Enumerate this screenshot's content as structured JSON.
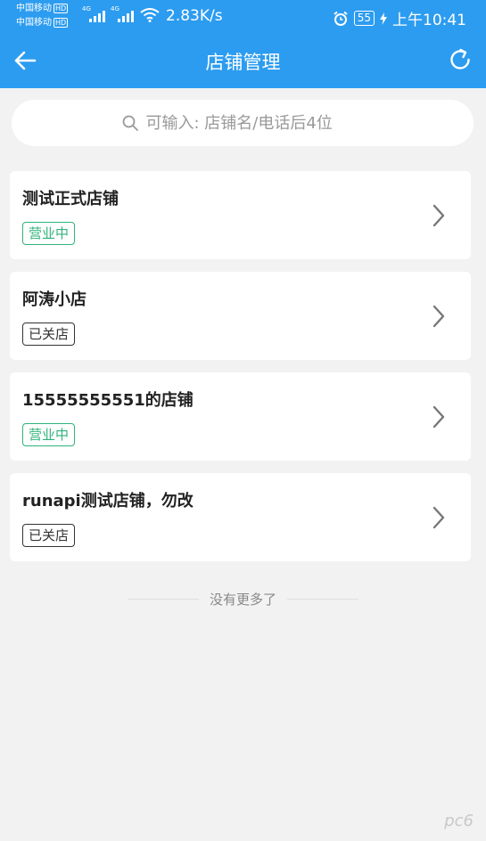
{
  "status_bar": {
    "carrier1": "中国移动",
    "carrier2": "中国移动",
    "hd": "HD",
    "net1": "4G",
    "net2": "4G",
    "speed": "2.83K/s",
    "battery": "55",
    "time": "上午10:41"
  },
  "header": {
    "title": "店铺管理",
    "back_icon": "arrow-left-icon",
    "refresh_icon": "refresh-icon"
  },
  "search": {
    "placeholder": "可输入: 店铺名/电话后4位",
    "value": "",
    "icon": "search-icon"
  },
  "stores": [
    {
      "name": "测试正式店铺",
      "status": "营业中",
      "status_color": "#2fb37a"
    },
    {
      "name": "阿涛小店",
      "status": "已关店",
      "status_color": "#333333"
    },
    {
      "name": "15555555551的店铺",
      "status": "营业中",
      "status_color": "#2fb37a"
    },
    {
      "name": "runapi测试店铺，勿改",
      "status": "已关店",
      "status_color": "#333333"
    }
  ],
  "footer": {
    "no_more": "没有更多了"
  },
  "watermark": "pc6",
  "colors": {
    "primary": "#2c9cf0",
    "open": "#2fb37a",
    "closed": "#333333",
    "background": "#f2f2f2"
  }
}
